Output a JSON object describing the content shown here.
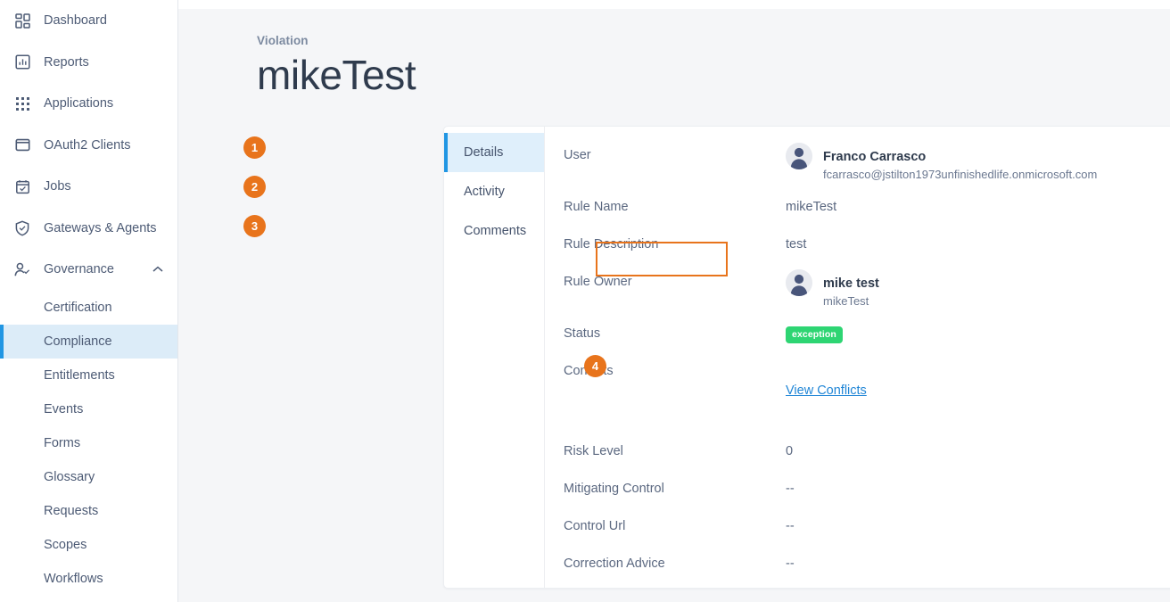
{
  "sidebar": {
    "items": [
      {
        "label": "Dashboard",
        "icon": "dashboard-icon"
      },
      {
        "label": "Reports",
        "icon": "reports-icon"
      },
      {
        "label": "Applications",
        "icon": "applications-grid-icon"
      },
      {
        "label": "OAuth2 Clients",
        "icon": "window-icon"
      },
      {
        "label": "Jobs",
        "icon": "calendar-check-icon"
      },
      {
        "label": "Gateways & Agents",
        "icon": "shield-check-icon"
      },
      {
        "label": "Governance",
        "icon": "user-check-icon",
        "expanded": true,
        "chevron": "chevron-up-icon"
      }
    ],
    "sub_items": [
      {
        "label": "Certification",
        "active": false
      },
      {
        "label": "Compliance",
        "active": true
      },
      {
        "label": "Entitlements",
        "active": false
      },
      {
        "label": "Events",
        "active": false
      },
      {
        "label": "Forms",
        "active": false
      },
      {
        "label": "Glossary",
        "active": false
      },
      {
        "label": "Requests",
        "active": false
      },
      {
        "label": "Scopes",
        "active": false
      },
      {
        "label": "Workflows",
        "active": false
      }
    ]
  },
  "header": {
    "breadcrumb": "Violation",
    "title": "mikeTest"
  },
  "tabs": [
    {
      "label": "Details",
      "active": true,
      "badge": "1"
    },
    {
      "label": "Activity",
      "active": false,
      "badge": "2"
    },
    {
      "label": "Comments",
      "active": false,
      "badge": "3"
    }
  ],
  "details": {
    "user": {
      "label": "User",
      "name": "Franco Carrasco",
      "email": "fcarrasco@jstilton1973unfinishedlife.onmicrosoft.com"
    },
    "rule_name": {
      "label": "Rule Name",
      "value": "mikeTest"
    },
    "rule_description": {
      "label": "Rule Description",
      "value": "test"
    },
    "rule_owner": {
      "label": "Rule Owner",
      "name": "mike test",
      "sub": "mikeTest"
    },
    "status": {
      "label": "Status",
      "value": "exception"
    },
    "conflicts": {
      "label": "Conflicts",
      "link": "View Conflicts",
      "badge": "4"
    },
    "risk_level": {
      "label": "Risk Level",
      "value": "0"
    },
    "mitigating_control": {
      "label": "Mitigating Control",
      "value": "--"
    },
    "control_url": {
      "label": "Control Url",
      "value": "--"
    },
    "correction_advice": {
      "label": "Correction Advice",
      "value": "--"
    }
  },
  "colors": {
    "accent_blue": "#2196e3",
    "annotation_orange": "#e8741c",
    "status_green": "#2ed573",
    "link_blue": "#2186d6",
    "page_bg": "#f5f6f8",
    "text_slate": "#5b6880"
  }
}
